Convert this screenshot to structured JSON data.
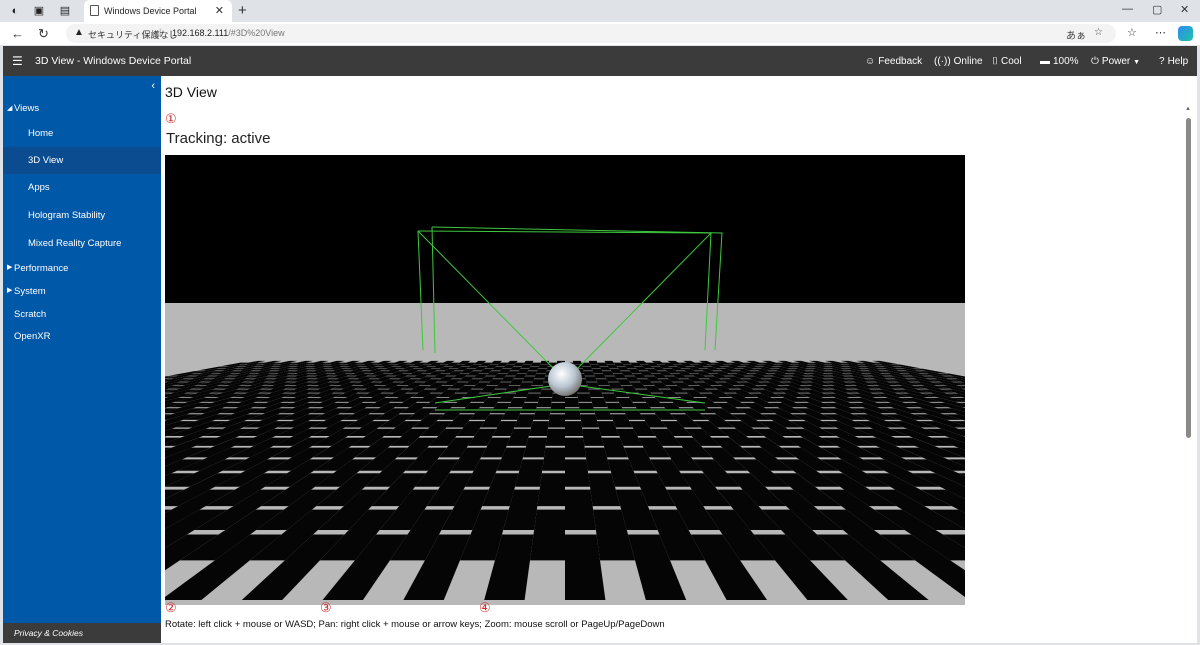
{
  "browser": {
    "tab_title": "Windows Device Portal",
    "new_tab": "+",
    "security_label": "セキュリティ保護なし",
    "url_host": "192.168.2.111",
    "url_path": "/#3D%20View",
    "reader_icon_text": "あぁ"
  },
  "header": {
    "app_title": "3D View - Windows Device Portal",
    "feedback": "Feedback",
    "online": "Online",
    "thermal": "Cool",
    "battery": "100%",
    "power": "Power",
    "help": "Help"
  },
  "sidebar": {
    "views_label": "Views",
    "items": [
      {
        "label": "Home"
      },
      {
        "label": "3D View"
      },
      {
        "label": "Apps"
      },
      {
        "label": "Hologram Stability"
      },
      {
        "label": "Mixed Reality Capture"
      }
    ],
    "performance": "Performance",
    "system": "System",
    "scratch": "Scratch",
    "openxr": "OpenXR",
    "footer": "Privacy & Cookies"
  },
  "main": {
    "title": "3D View",
    "tracking": "Tracking: active",
    "controls_text": "Rotate: left click + mouse or WASD; Pan: right click + mouse or arrow keys; Zoom: mouse scroll or PageUp/PageDown",
    "markers": [
      "①",
      "②",
      "③",
      "④"
    ]
  },
  "colors": {
    "sidebar_bg": "#0058a8",
    "sidebar_selected": "#0a4c8f",
    "header_bg": "#3b3b3b",
    "marker": "#d12b2b",
    "frustum": "#3ec83e"
  },
  "icons": [
    "hamburger-icon",
    "feedback-icon",
    "online-icon",
    "thermal-icon",
    "battery-icon",
    "power-icon",
    "help-icon",
    "back-icon",
    "refresh-icon"
  ]
}
